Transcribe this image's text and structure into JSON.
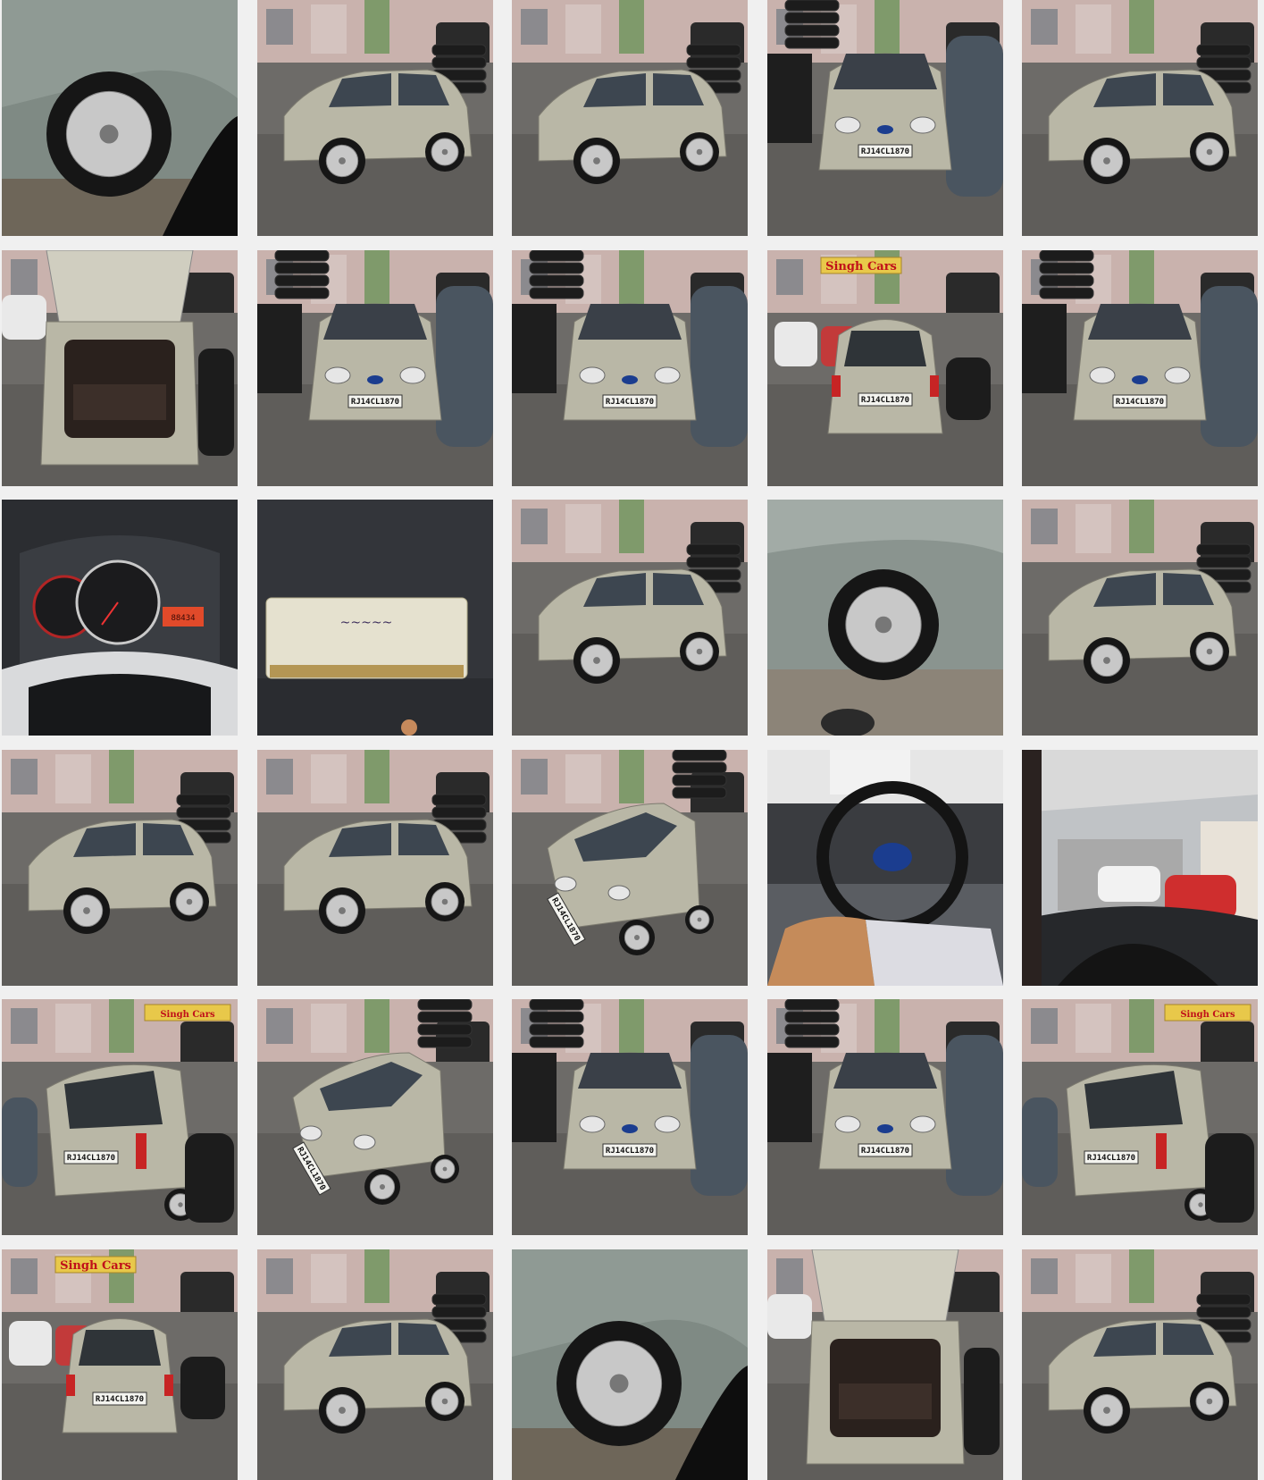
{
  "gallery": {
    "columns": 5,
    "rows": 6,
    "plate_number": "RJ14CL1870",
    "shop_sign": "Singh Cars",
    "colors": {
      "background": "#f0f0f0",
      "car_body": "#b9b7a6",
      "asphalt": "#6d6b68",
      "sign_yellow": "#e8c84a",
      "tyre_black": "#1c1c1c"
    },
    "photos": [
      {
        "view": "side-wheel-close"
      },
      {
        "view": "side-left"
      },
      {
        "view": "side-left"
      },
      {
        "view": "front"
      },
      {
        "view": "side-left"
      },
      {
        "view": "boot-open"
      },
      {
        "view": "front"
      },
      {
        "view": "front"
      },
      {
        "view": "rear"
      },
      {
        "view": "front"
      },
      {
        "view": "dashboard-gauges"
      },
      {
        "view": "key-tag"
      },
      {
        "view": "side-left"
      },
      {
        "view": "front-wheel-close"
      },
      {
        "view": "side-left"
      },
      {
        "view": "side-left"
      },
      {
        "view": "side-left"
      },
      {
        "view": "front-angle"
      },
      {
        "view": "steering-interior"
      },
      {
        "view": "windshield-interior"
      },
      {
        "view": "rear-angle"
      },
      {
        "view": "front-angle"
      },
      {
        "view": "front"
      },
      {
        "view": "front"
      },
      {
        "view": "rear-angle"
      },
      {
        "view": "rear"
      },
      {
        "view": "side-left"
      },
      {
        "view": "side-wheel-close"
      },
      {
        "view": "boot-open"
      },
      {
        "view": "side-left"
      }
    ]
  }
}
